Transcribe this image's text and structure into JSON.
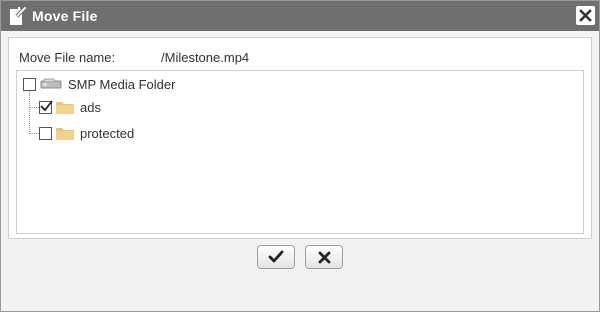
{
  "dialog": {
    "title": "Move File",
    "file_name_label": "Move File name:",
    "file_name_value": "/Milestone.mp4"
  },
  "tree": {
    "root": {
      "label": "SMP Media Folder",
      "checked": false
    },
    "children": [
      {
        "label": "ads",
        "checked": true
      },
      {
        "label": "protected",
        "checked": false
      }
    ]
  },
  "icons": {
    "title": "move-file-icon",
    "close": "close-icon",
    "confirm": "checkmark-icon",
    "cancel": "x-icon"
  },
  "colors": {
    "titlebar": "#6f6f6f",
    "folder": "#e8c77a"
  }
}
